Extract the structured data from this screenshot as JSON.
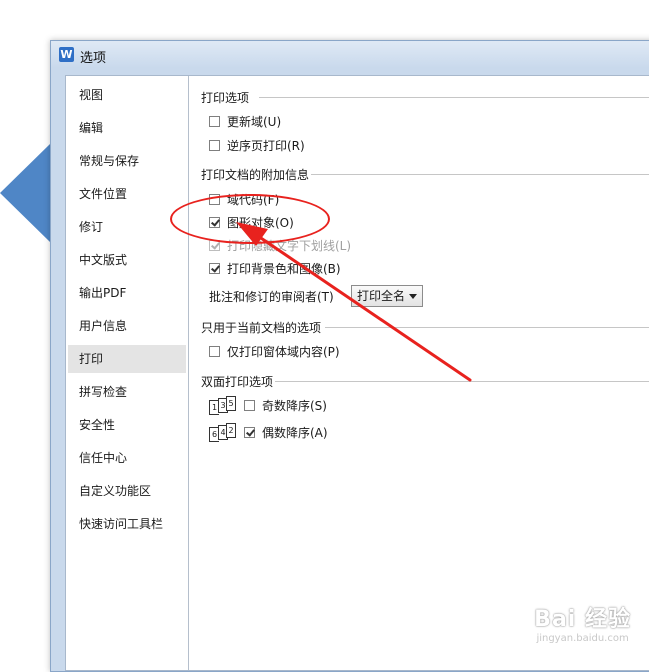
{
  "window": {
    "title": "选项",
    "app_icon_letter": "W"
  },
  "sidebar": {
    "items": [
      {
        "label": "视图"
      },
      {
        "label": "编辑"
      },
      {
        "label": "常规与保存"
      },
      {
        "label": "文件位置"
      },
      {
        "label": "修订"
      },
      {
        "label": "中文版式"
      },
      {
        "label": "输出PDF"
      },
      {
        "label": "用户信息"
      },
      {
        "label": "打印",
        "selected": true
      },
      {
        "label": "拼写检查"
      },
      {
        "label": "安全性"
      },
      {
        "label": "信任中心"
      },
      {
        "label": "自定义功能区"
      },
      {
        "label": "快速访问工具栏"
      }
    ]
  },
  "print_options": {
    "title": "打印选项",
    "update_fields": {
      "label": "更新域(U)",
      "checked": false
    },
    "reverse_order": {
      "label": "逆序页打印(R)",
      "checked": false
    }
  },
  "additional_info": {
    "title": "打印文档的附加信息",
    "field_codes": {
      "label": "域代码(F)",
      "checked": false
    },
    "drawing_objects": {
      "label": "图形对象(O)",
      "checked": true
    },
    "hidden_text": {
      "label": "打印隐藏文字下划线(L)",
      "checked": true,
      "disabled": true
    },
    "background": {
      "label": "打印背景色和图像(B)",
      "checked": true
    },
    "reviewer_label": "批注和修订的审阅者(T)",
    "reviewer_value": "打印全名"
  },
  "current_doc": {
    "title": "只用于当前文档的选项",
    "form_data_only": {
      "label": "仅打印窗体域内容(P)",
      "checked": false
    }
  },
  "duplex": {
    "title": "双面打印选项",
    "odd_reverse": {
      "label": "奇数降序(S)",
      "checked": false,
      "icon_pages": [
        "1",
        "3",
        "5"
      ]
    },
    "even_reverse": {
      "label": "偶数降序(A)",
      "checked": true,
      "icon_pages": [
        "6",
        "4",
        "2"
      ]
    }
  },
  "annotation_color": "#e8221e",
  "watermark": {
    "main": "Bai 经验",
    "sub": "jingyan.baidu.com"
  }
}
